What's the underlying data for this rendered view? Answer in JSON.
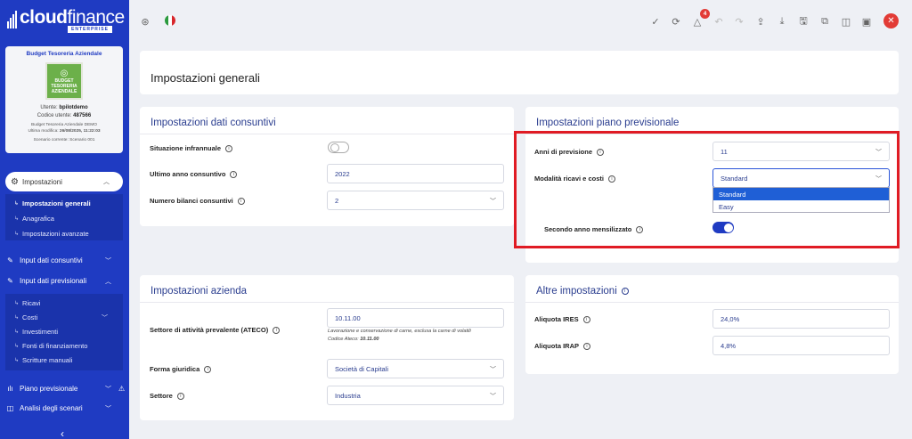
{
  "app": {
    "logo_main": "cloud",
    "logo_thin": "finance",
    "logo_sub": "ENTERPRISE"
  },
  "budget": {
    "title": "Budget Tesoreria Aziendale",
    "image_text_1": "BUDGET TESORERIA",
    "image_text_2": "AZIENDALE",
    "user_label": "Utente:",
    "user_value": "bpilotdemo",
    "code_label": "Codice utente:",
    "code_value": "487566",
    "name": "Budget Tesoreria Aziendale DEMO",
    "last_mod_label": "Ultima modifica:",
    "last_mod_value": "26/08/2025, 11:22:03",
    "scenario": "Scenario corrente: Scenario 001"
  },
  "sidebar": {
    "impostazioni": "Impostazioni",
    "sub_impostazioni": [
      "Impostazioni generali",
      "Anagrafica",
      "Impostazioni avanzate"
    ],
    "input_consuntivi": "Input dati consuntivi",
    "input_previsionali": "Input dati previsionali",
    "sub_previsionali": [
      "Ricavi",
      "Costi",
      "Investimenti",
      "Fonti di finanziamento",
      "Scritture manuali"
    ],
    "piano_previsionale": "Piano previsionale",
    "analisi_scenari": "Analisi degli scenari"
  },
  "topbar": {
    "notifications_count": "4"
  },
  "page": {
    "title": "Impostazioni generali"
  },
  "consuntivi": {
    "title": "Impostazioni dati consuntivi",
    "situazione_label": "Situazione infrannuale",
    "ultimo_anno_label": "Ultimo anno consuntivo",
    "ultimo_anno_value": "2022",
    "numero_bilanci_label": "Numero bilanci consuntivi",
    "numero_bilanci_value": "2"
  },
  "piano": {
    "title": "Impostazioni piano previsionale",
    "anni_label": "Anni di previsione",
    "anni_value": "11",
    "modalita_label": "Modalità ricavi e costi",
    "modalita_value": "Standard",
    "modalita_options": [
      "Standard",
      "Easy"
    ],
    "secondo_anno_label": "Secondo anno mensilizzato"
  },
  "azienda": {
    "title": "Impostazioni azienda",
    "settore_attivita_label": "Settore di attività prevalente (ATECO)",
    "ateco_value": "10.11.00",
    "ateco_desc": "Lavorazione e conservazione di carne, esclusa la carne di volatili",
    "ateco_code_label": "Codice Ateco:",
    "ateco_code_value": "10.11.00",
    "forma_label": "Forma giuridica",
    "forma_value": "Società di Capitali",
    "settore_label": "Settore",
    "settore_value": "Industria"
  },
  "altre": {
    "title": "Altre impostazioni",
    "ires_label": "Aliquota IRES",
    "ires_value": "24,0%",
    "irap_label": "Aliquota IRAP",
    "irap_value": "4,8%"
  }
}
